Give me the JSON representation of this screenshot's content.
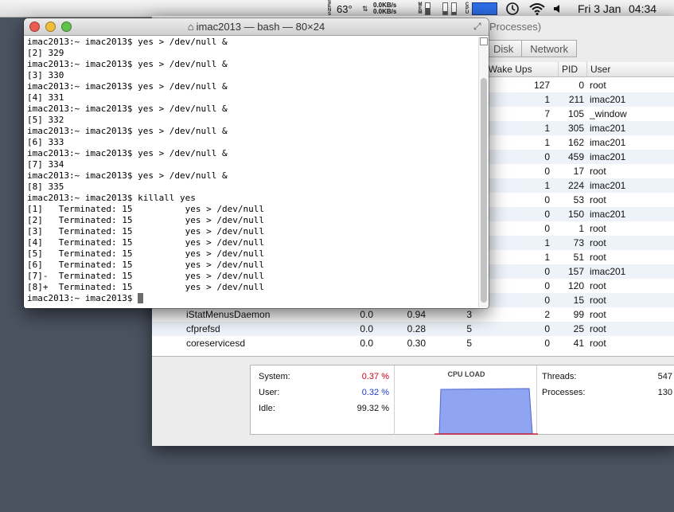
{
  "menubar": {
    "sensor_label": "SENS",
    "temperature": "63°",
    "net_up": "0.0KB/s",
    "net_down": "0.0KB/s",
    "mem_label": "MEM",
    "cpu_label": "CPU",
    "date": "Fri 3 Jan",
    "time": "04:34"
  },
  "activity_monitor": {
    "title_partial": "Processes)",
    "tabs": [
      "Disk",
      "Network"
    ],
    "columns": {
      "idle_wake_ups": "le Wake Ups",
      "pid": "PID",
      "user": "User"
    },
    "rows": [
      {
        "name": "",
        "cpu": "",
        "time": "",
        "threads": "",
        "idle": "127",
        "pid": "0",
        "user": "root"
      },
      {
        "name": "",
        "cpu": "",
        "time": "",
        "threads": "",
        "idle": "1",
        "pid": "211",
        "user": "imac201"
      },
      {
        "name": "",
        "cpu": "",
        "time": "",
        "threads": "",
        "idle": "7",
        "pid": "105",
        "user": "_window"
      },
      {
        "name": "",
        "cpu": "",
        "time": "",
        "threads": "",
        "idle": "1",
        "pid": "305",
        "user": "imac201"
      },
      {
        "name": "",
        "cpu": "",
        "time": "",
        "threads": "",
        "idle": "1",
        "pid": "162",
        "user": "imac201"
      },
      {
        "name": "",
        "cpu": "",
        "time": "",
        "threads": "",
        "idle": "0",
        "pid": "459",
        "user": "imac201"
      },
      {
        "name": "",
        "cpu": "",
        "time": "",
        "threads": "",
        "idle": "0",
        "pid": "17",
        "user": "root"
      },
      {
        "name": "",
        "cpu": "",
        "time": "",
        "threads": "",
        "idle": "1",
        "pid": "224",
        "user": "imac201"
      },
      {
        "name": "",
        "cpu": "",
        "time": "",
        "threads": "",
        "idle": "0",
        "pid": "53",
        "user": "root"
      },
      {
        "name": "",
        "cpu": "",
        "time": "",
        "threads": "",
        "idle": "0",
        "pid": "150",
        "user": "imac201"
      },
      {
        "name": "",
        "cpu": "",
        "time": "",
        "threads": "",
        "idle": "0",
        "pid": "1",
        "user": "root"
      },
      {
        "name": "",
        "cpu": "",
        "time": "",
        "threads": "",
        "idle": "1",
        "pid": "73",
        "user": "root"
      },
      {
        "name": "",
        "cpu": "",
        "time": "",
        "threads": "",
        "idle": "1",
        "pid": "51",
        "user": "root"
      },
      {
        "name": "",
        "cpu": "",
        "time": "",
        "threads": "",
        "idle": "0",
        "pid": "157",
        "user": "imac201"
      },
      {
        "name": "",
        "cpu": "",
        "time": "",
        "threads": "",
        "idle": "0",
        "pid": "120",
        "user": "root"
      },
      {
        "name": "",
        "cpu": "",
        "time": "",
        "threads": "",
        "idle": "0",
        "pid": "15",
        "user": "root"
      },
      {
        "name": "iStatMenusDaemon",
        "cpu": "0.0",
        "time": "0.94",
        "threads": "3",
        "idle": "2",
        "pid": "99",
        "user": "root"
      },
      {
        "name": "cfprefsd",
        "cpu": "0.0",
        "time": "0.28",
        "threads": "5",
        "idle": "0",
        "pid": "25",
        "user": "root"
      },
      {
        "name": "coreservicesd",
        "cpu": "0.0",
        "time": "0.30",
        "threads": "5",
        "idle": "0",
        "pid": "41",
        "user": "root"
      }
    ],
    "stats": {
      "system_label": "System:",
      "system_value": "0.37 %",
      "user_label": "User:",
      "user_value": "0.32 %",
      "idle_label": "Idle:",
      "idle_value": "99.32 %",
      "cpu_load_title": "CPU LOAD",
      "threads_label": "Threads:",
      "threads_value": "547",
      "processes_label": "Processes:",
      "processes_value": "130",
      "system_color": "#d0021b",
      "user_color": "#1f3fcf"
    }
  },
  "terminal": {
    "title": "imac2013 — bash — 80×24",
    "lines": [
      "imac2013:~ imac2013$ yes > /dev/null &",
      "[2] 329",
      "imac2013:~ imac2013$ yes > /dev/null &",
      "[3] 330",
      "imac2013:~ imac2013$ yes > /dev/null &",
      "[4] 331",
      "imac2013:~ imac2013$ yes > /dev/null &",
      "[5] 332",
      "imac2013:~ imac2013$ yes > /dev/null &",
      "[6] 333",
      "imac2013:~ imac2013$ yes > /dev/null &",
      "[7] 334",
      "imac2013:~ imac2013$ yes > /dev/null &",
      "[8] 335",
      "imac2013:~ imac2013$ killall yes",
      "[1]   Terminated: 15          yes > /dev/null",
      "[2]   Terminated: 15          yes > /dev/null",
      "[3]   Terminated: 15          yes > /dev/null",
      "[4]   Terminated: 15          yes > /dev/null",
      "[5]   Terminated: 15          yes > /dev/null",
      "[6]   Terminated: 15          yes > /dev/null",
      "[7]-  Terminated: 15          yes > /dev/null",
      "[8]+  Terminated: 15          yes > /dev/null"
    ],
    "prompt": "imac2013:~ imac2013$ "
  },
  "colors": {
    "desktop": "#4b5361",
    "close": "#ec5b52",
    "minimize": "#f0be3b",
    "zoom": "#5fc24c",
    "cpu_graph_fill": "#8fa5f2"
  }
}
